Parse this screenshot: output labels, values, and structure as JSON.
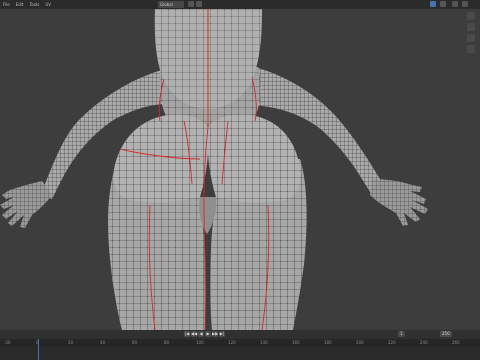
{
  "app": {
    "menu": [
      "File",
      "Edit",
      "Tools",
      "UV"
    ],
    "mode": "Global"
  },
  "icons": {
    "menu_icons": [
      "file-menu",
      "edit-menu",
      "tools-menu",
      "uv-menu"
    ],
    "header_tools": [
      "snap-icon",
      "proportional-edit-icon",
      "overlay-icon",
      "shading-icon"
    ],
    "gizmo": [
      "zoom-icon",
      "pan-icon",
      "camera-icon",
      "grid-icon"
    ]
  },
  "colors": {
    "background": "#3d3d3d",
    "mesh_fill": "#a9a9a9",
    "mesh_wire": "#2a2a2a",
    "seam": "#d62828",
    "accent": "#4772b3"
  },
  "timeline": {
    "start": "1",
    "end": "250",
    "ticks": [
      "-20",
      "0",
      "20",
      "40",
      "60",
      "80",
      "100",
      "120",
      "140",
      "160",
      "180",
      "200",
      "220",
      "240",
      "260"
    ]
  }
}
